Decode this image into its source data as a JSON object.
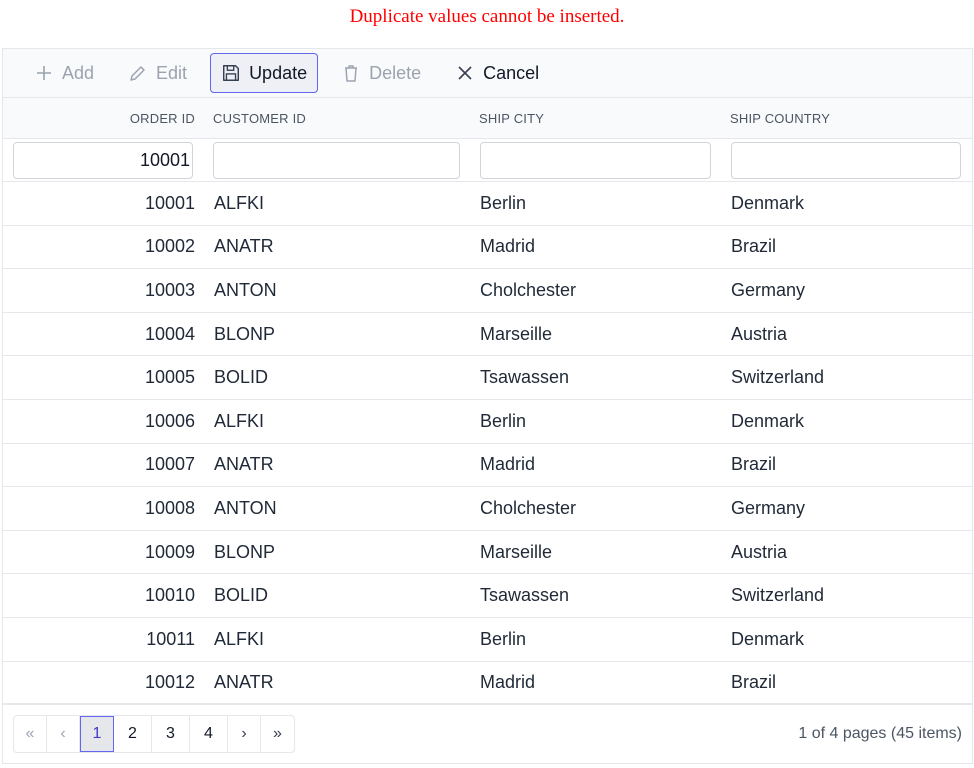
{
  "error": "Duplicate values cannot be inserted.",
  "toolbar": {
    "add": "Add",
    "edit": "Edit",
    "update": "Update",
    "delete": "Delete",
    "cancel": "Cancel"
  },
  "columns": {
    "order_id": "ORDER ID",
    "customer_id": "CUSTOMER ID",
    "ship_city": "SHIP CITY",
    "ship_country": "SHIP COUNTRY"
  },
  "edit_row": {
    "order_id": "10001",
    "customer_id": "",
    "ship_city": "",
    "ship_country": ""
  },
  "rows": [
    {
      "order_id": "10001",
      "customer_id": "ALFKI",
      "ship_city": "Berlin",
      "ship_country": "Denmark"
    },
    {
      "order_id": "10002",
      "customer_id": "ANATR",
      "ship_city": "Madrid",
      "ship_country": "Brazil"
    },
    {
      "order_id": "10003",
      "customer_id": "ANTON",
      "ship_city": "Cholchester",
      "ship_country": "Germany"
    },
    {
      "order_id": "10004",
      "customer_id": "BLONP",
      "ship_city": "Marseille",
      "ship_country": "Austria"
    },
    {
      "order_id": "10005",
      "customer_id": "BOLID",
      "ship_city": "Tsawassen",
      "ship_country": "Switzerland"
    },
    {
      "order_id": "10006",
      "customer_id": "ALFKI",
      "ship_city": "Berlin",
      "ship_country": "Denmark"
    },
    {
      "order_id": "10007",
      "customer_id": "ANATR",
      "ship_city": "Madrid",
      "ship_country": "Brazil"
    },
    {
      "order_id": "10008",
      "customer_id": "ANTON",
      "ship_city": "Cholchester",
      "ship_country": "Germany"
    },
    {
      "order_id": "10009",
      "customer_id": "BLONP",
      "ship_city": "Marseille",
      "ship_country": "Austria"
    },
    {
      "order_id": "10010",
      "customer_id": "BOLID",
      "ship_city": "Tsawassen",
      "ship_country": "Switzerland"
    },
    {
      "order_id": "10011",
      "customer_id": "ALFKI",
      "ship_city": "Berlin",
      "ship_country": "Denmark"
    },
    {
      "order_id": "10012",
      "customer_id": "ANATR",
      "ship_city": "Madrid",
      "ship_country": "Brazil"
    }
  ],
  "pager": {
    "first": "«",
    "prev": "‹",
    "pages": [
      "1",
      "2",
      "3",
      "4"
    ],
    "current": "1",
    "next": "›",
    "last": "»",
    "info": "1 of 4 pages (45 items)"
  },
  "colors": {
    "error": "#ff0000",
    "accent": "#6366f1"
  }
}
